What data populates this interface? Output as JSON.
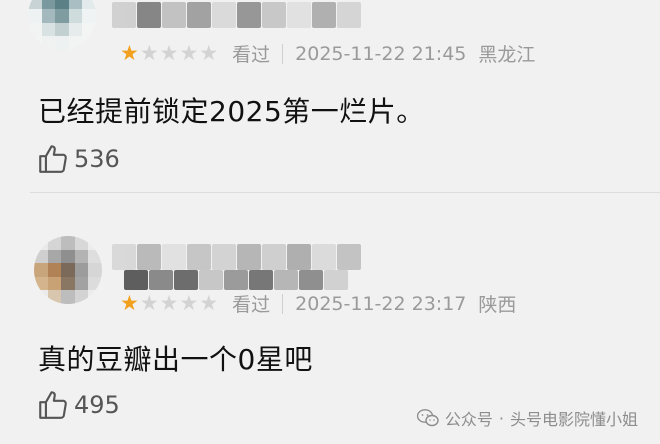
{
  "comments": [
    {
      "rating": 1,
      "max_rating": 5,
      "status": "看过",
      "datetime": "2025-11-22 21:45",
      "location": "黑龙江",
      "text": "已经提前锁定2025第一烂片。",
      "likes": "536"
    },
    {
      "rating": 1,
      "max_rating": 5,
      "status": "看过",
      "datetime": "2025-11-22 23:17",
      "location": "陕西",
      "text": "真的豆瓣出一个0星吧",
      "likes": "495"
    }
  ],
  "watermark": {
    "channel": "公众号",
    "separator": "·",
    "account": "头号电影院懂小姐"
  },
  "colors": {
    "background": "#f1f1f1",
    "star_active": "#f2a11f",
    "star_inactive": "#d3d3d3",
    "meta_text": "#9a9a9a"
  }
}
